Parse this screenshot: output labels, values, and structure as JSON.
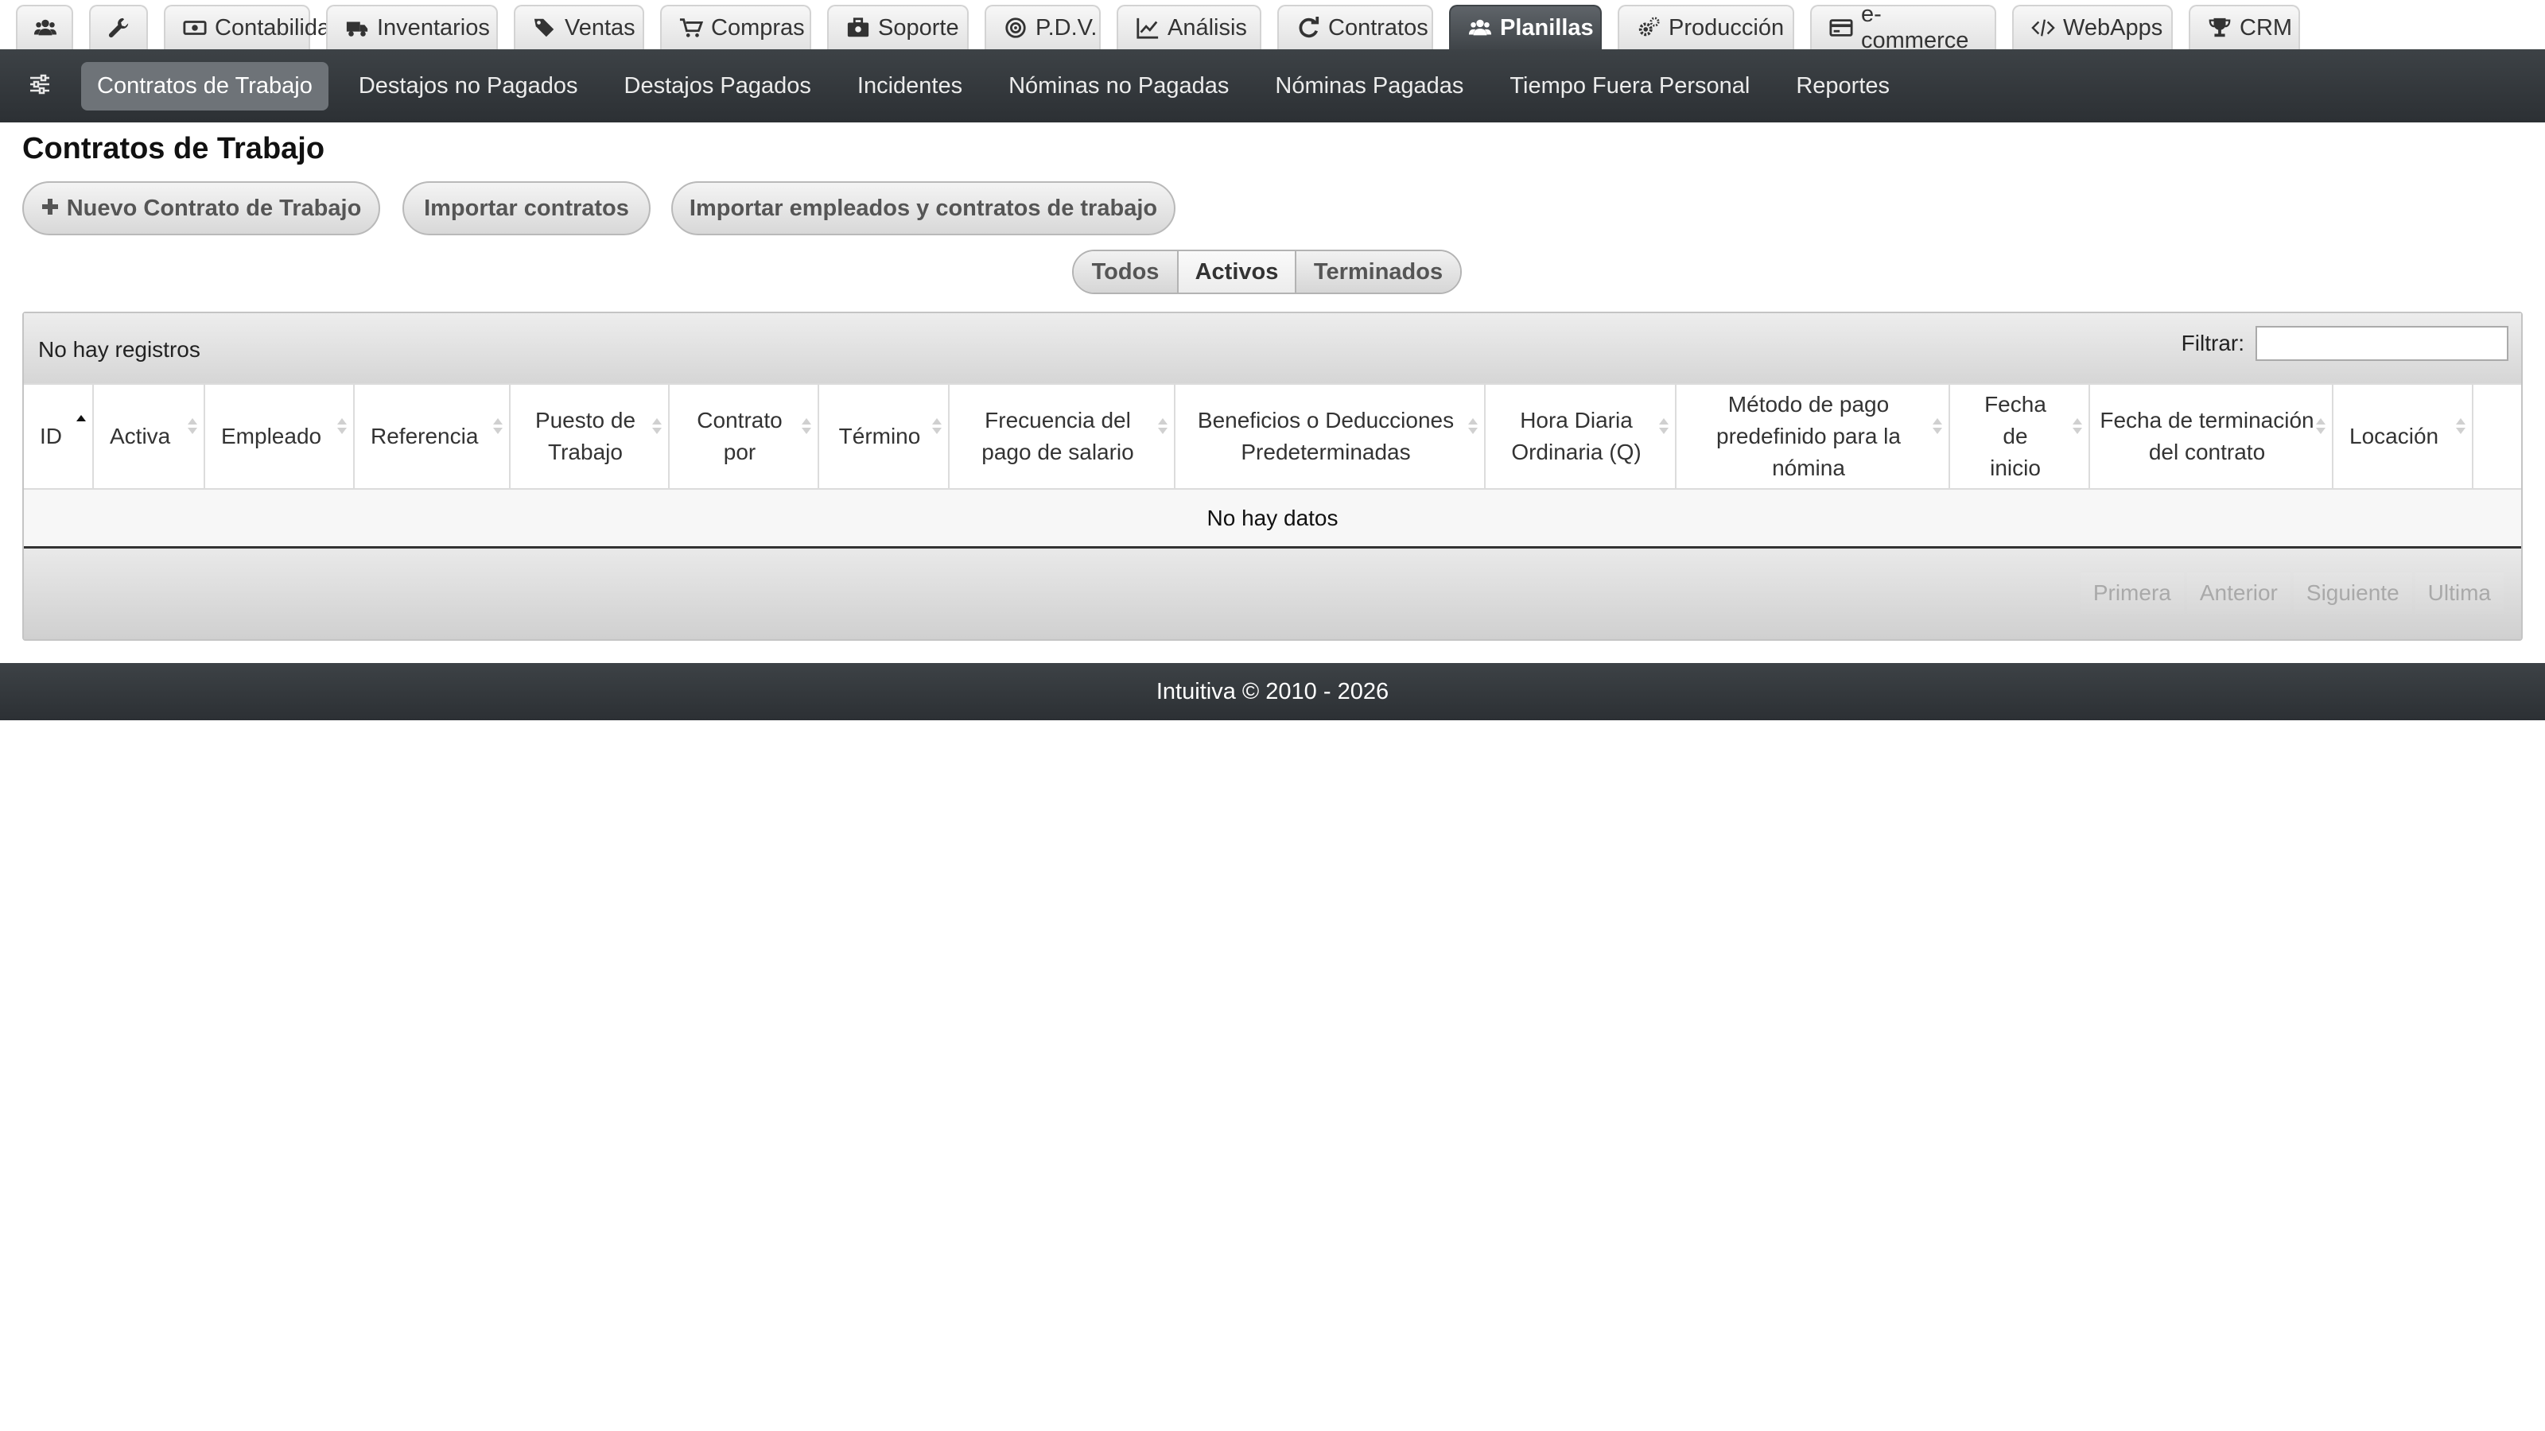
{
  "top_tabs": [
    {
      "label": "",
      "icon": "users-icon"
    },
    {
      "label": "",
      "icon": "wrench-icon"
    },
    {
      "label": "Contabilidad",
      "icon": "money-icon"
    },
    {
      "label": "Inventarios",
      "icon": "truck-icon"
    },
    {
      "label": "Ventas",
      "icon": "tags-icon"
    },
    {
      "label": "Compras",
      "icon": "cart-icon"
    },
    {
      "label": "Soporte",
      "icon": "briefcase-icon"
    },
    {
      "label": "P.D.V.",
      "icon": "target-icon"
    },
    {
      "label": "Análisis",
      "icon": "chart-icon"
    },
    {
      "label": "Contratos",
      "icon": "refresh-icon"
    },
    {
      "label": "Planillas",
      "icon": "users-icon",
      "active": true
    },
    {
      "label": "Producción",
      "icon": "gears-icon"
    },
    {
      "label": "e-commerce",
      "icon": "card-icon"
    },
    {
      "label": "WebApps",
      "icon": "code-icon"
    },
    {
      "label": "CRM",
      "icon": "trophy-icon"
    }
  ],
  "sub_nav": {
    "toggle_icon": "sliders-icon",
    "items": [
      {
        "label": "Contratos de Trabajo",
        "active": true
      },
      {
        "label": "Destajos no Pagados"
      },
      {
        "label": "Destajos Pagados"
      },
      {
        "label": "Incidentes"
      },
      {
        "label": "Nóminas no Pagadas"
      },
      {
        "label": "Nóminas Pagadas"
      },
      {
        "label": "Tiempo Fuera Personal"
      },
      {
        "label": "Reportes"
      }
    ]
  },
  "page": {
    "title": "Contratos de Trabajo",
    "buttons": {
      "new_contract": "Nuevo Contrato de Trabajo",
      "import_contracts": "Importar contratos",
      "import_employees": "Importar empleados y contratos de trabajo"
    },
    "filter_tabs": [
      "Todos",
      "Activos",
      "Terminados"
    ],
    "selected_filter": "Activos"
  },
  "table": {
    "records_info": "No hay registros",
    "filter_label": "Filtrar:",
    "filter_value": "",
    "columns": [
      "ID",
      "Activa",
      "Empleado",
      "Referencia",
      "Puesto de Trabajo",
      "Contrato por",
      "Término",
      "Frecuencia del pago de salario",
      "Beneficios o Deducciones Predeterminadas",
      "Hora Diaria Ordinaria (Q)",
      "Método de pago predefinido para la nómina",
      "Fecha de inicio",
      "Fecha de terminación del contrato",
      "Locación"
    ],
    "sorted_column": "ID",
    "sort_direction": "ascending",
    "empty_message": "No hay datos",
    "pager": [
      "Primera",
      "Anterior",
      "Siguiente",
      "Ultima"
    ]
  },
  "footer": {
    "text": "Intuitiva © 2010 - 2026"
  },
  "colors": {
    "nav_dark": "#35393d",
    "active_tab": "#4a4f54",
    "active_sub_item": "#6e7378"
  }
}
